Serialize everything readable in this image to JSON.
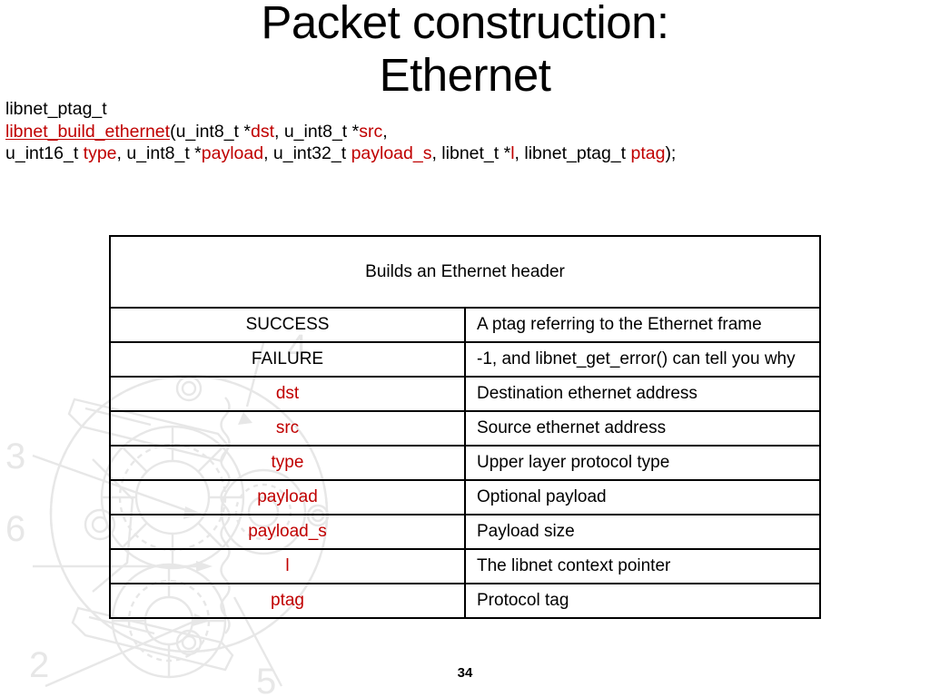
{
  "slide": {
    "title": "Packet construction:\nEthernet",
    "page_number": "34",
    "accent_color": "#C00000",
    "text_color": "#000000",
    "watermark_color": "#E7E7E7"
  },
  "prototype": {
    "return_type": "libnet_ptag_t",
    "function_name": "libnet_build_ethernet",
    "line2_open": "(",
    "line2_seg1": "u_int8_t *",
    "line2_arg1": "dst",
    "line2_seg2": ", u_int8_t *",
    "line2_arg2": "src",
    "line2_seg3": ",",
    "line3_seg1": "u_int16_t ",
    "line3_arg1": "type",
    "line3_seg2": ", u_int8_t *",
    "line3_arg2": "payload",
    "line3_seg3": ", u_int32_t ",
    "line3_arg3": "payload_s",
    "line3_seg4": ", libnet_t *",
    "line3_arg4": "l",
    "line3_seg5": ", libnet_ptag_t ",
    "line3_arg5": "ptag",
    "line3_seg6": ");"
  },
  "table": {
    "header": "Builds an Ethernet header",
    "rows": [
      {
        "key": "SUCCESS",
        "key_color": "black",
        "value": "A ptag referring to the Ethernet frame"
      },
      {
        "key": "FAILURE",
        "key_color": "black",
        "value": "-1, and libnet_get_error() can tell you why"
      },
      {
        "key": "dst",
        "key_color": "red",
        "value": "Destination ethernet address"
      },
      {
        "key": "src",
        "key_color": "red",
        "value": "Source ethernet address"
      },
      {
        "key": "type",
        "key_color": "red",
        "value": "Upper layer protocol type"
      },
      {
        "key": "payload",
        "key_color": "red",
        "value": "Optional payload"
      },
      {
        "key": "payload_s",
        "key_color": "red",
        "value": "Payload size"
      },
      {
        "key": "l",
        "key_color": "red",
        "value": "The libnet context pointer"
      },
      {
        "key": "ptag",
        "key_color": "red",
        "value": "Protocol tag"
      }
    ]
  },
  "watermark": {
    "callouts": [
      "2",
      "3",
      "4",
      "5",
      "6"
    ]
  }
}
